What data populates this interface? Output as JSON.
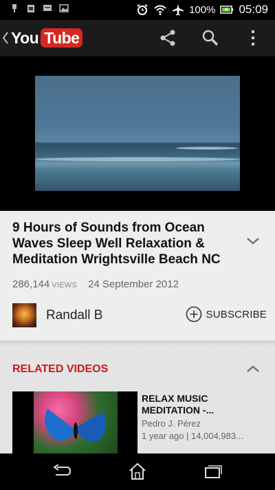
{
  "status_bar": {
    "battery_percent": "100%",
    "time": "05:09",
    "icons": [
      "usb-icon",
      "sim-icon",
      "message-icon",
      "image-icon",
      "alarm-icon",
      "wifi-icon",
      "airplane-icon",
      "battery-icon"
    ]
  },
  "app_bar": {
    "logo_you": "You",
    "logo_tube": "Tube",
    "actions": [
      "share-icon",
      "search-icon",
      "overflow-menu-icon"
    ]
  },
  "video": {
    "title": "9 Hours of Sounds from Ocean Waves Sleep Well Relaxation & Meditation Wrightsville Beach NC",
    "views_count": "286,144",
    "views_label": "VIEWS",
    "date": "24 September 2012"
  },
  "channel": {
    "name": "Randall B",
    "subscribe_label": "SUBSCRIBE"
  },
  "related": {
    "header": "RELATED VIDEOS",
    "items": [
      {
        "title": "RELAX MUSIC MEDITATION -...",
        "author": "Pedro J. Pérez",
        "stats": "1 year ago | 14,004,983..."
      }
    ]
  },
  "colors": {
    "brand_red": "#d62722",
    "related_header": "#cc181e",
    "app_bar_bg": "#1b1b1b"
  }
}
